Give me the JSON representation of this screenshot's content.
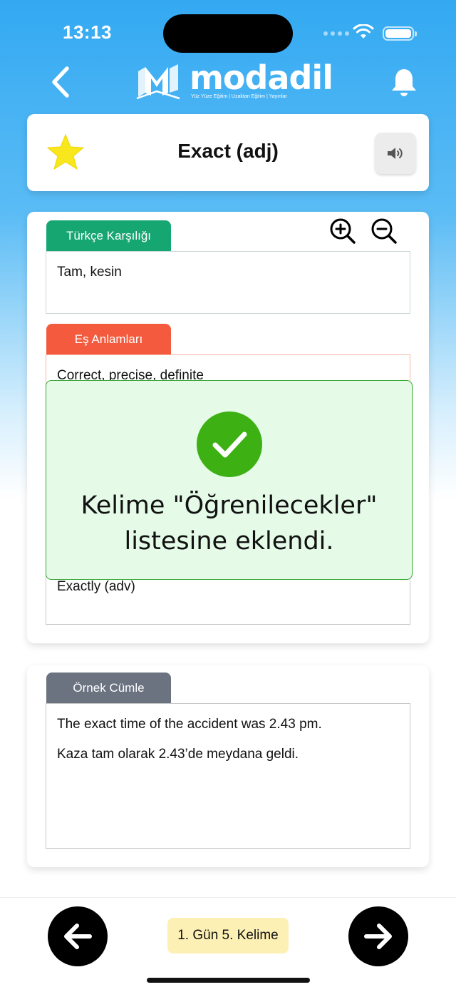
{
  "status_bar": {
    "time": "13:13"
  },
  "header": {
    "logo_text": "modadil",
    "logo_tagline": "Yüz Yüze Eğitim  |  Uzaktan Eğitim  |  Yayınlar"
  },
  "word_card": {
    "word": "Exact (adj)",
    "favorited": true
  },
  "detail": {
    "turkish_tab": "Türkçe Karşılığı",
    "turkish_value": "Tam, kesin",
    "synonyms_tab": "Eş Anlamları",
    "synonyms_value": "Correct, precise, definite",
    "related_value": "Exactly (adv)"
  },
  "example": {
    "tab": "Örnek Cümle",
    "sentence_en": "The exact time of the accident was 2.43 pm.",
    "sentence_tr": "Kaza tam olarak 2.43’de meydana geldi."
  },
  "toast": {
    "message": "Kelime \"Öğrenilecekler\" listesine eklendi."
  },
  "bottom_nav": {
    "progress_label": "1. Gün 5. Kelime"
  },
  "colors": {
    "accent_blue": "#33a9f2",
    "green": "#16a672",
    "red": "#f45b3e",
    "gray": "#6b7280",
    "star": "#f8e71c",
    "toast_bg": "#e5fbe8",
    "check": "#3db013"
  },
  "icons": [
    "back-chevron-icon",
    "bell-icon",
    "star-icon",
    "speaker-icon",
    "zoom-in-icon",
    "zoom-out-icon",
    "check-icon",
    "arrow-left-icon",
    "arrow-right-icon",
    "wifi-icon",
    "battery-icon"
  ]
}
